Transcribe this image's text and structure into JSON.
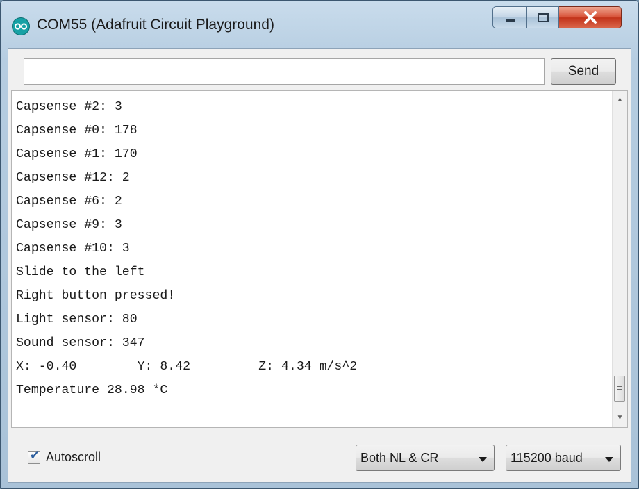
{
  "window": {
    "title": "COM55 (Adafruit Circuit Playground)",
    "icon": "arduino-infinity-icon",
    "accent_color": "#17a1a5",
    "close_color": "#c2331a"
  },
  "send_bar": {
    "input_value": "",
    "send_label": "Send"
  },
  "output_lines": [
    "Capsense #2: 3",
    "Capsense #0: 178",
    "Capsense #1: 170",
    "Capsense #12: 2",
    "Capsense #6: 2",
    "Capsense #9: 3",
    "Capsense #10: 3",
    "Slide to the left",
    "Right button pressed!",
    "Light sensor: 80",
    "Sound sensor: 347",
    "X: -0.40        Y: 8.42         Z: 4.34 m/s^2",
    "Temperature 28.98 *C"
  ],
  "footer": {
    "autoscroll_label": "Autoscroll",
    "autoscroll_checked": true,
    "line_ending_selected": "Both NL & CR",
    "baud_selected": "115200 baud"
  }
}
